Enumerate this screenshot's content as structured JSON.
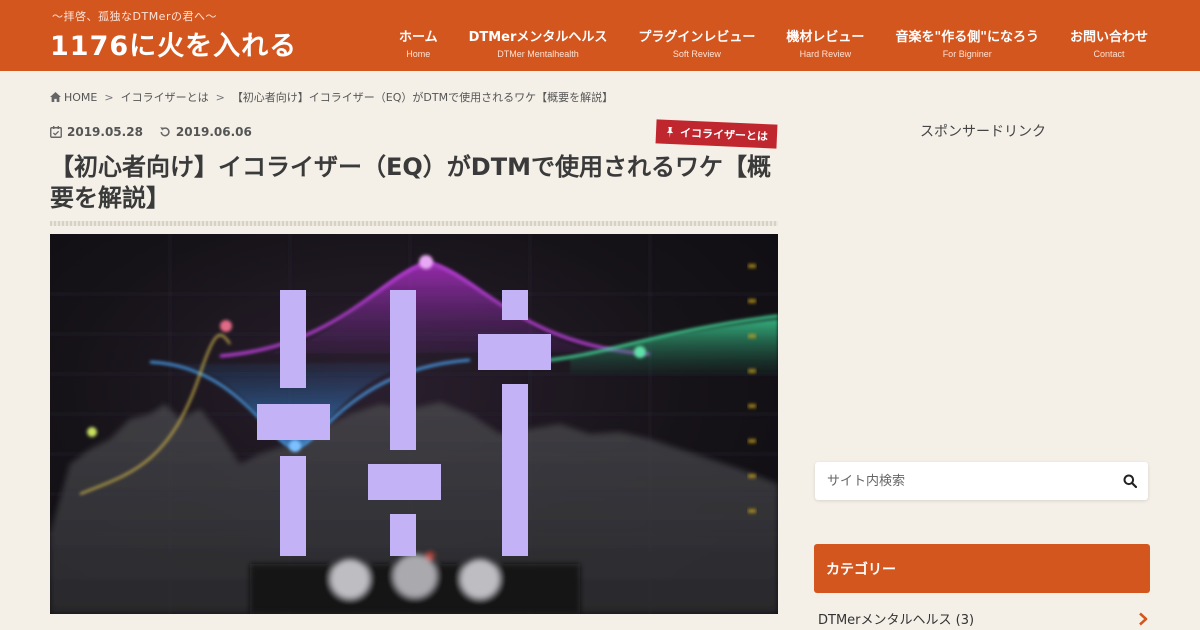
{
  "site": {
    "tagline": "～拝啓、孤独なDTMerの君へ～",
    "title": "1176に火を入れる"
  },
  "nav": [
    {
      "label": "ホーム",
      "sub": "Home"
    },
    {
      "label": "DTMerメンタルヘルス",
      "sub": "DTMer Mentalhealth"
    },
    {
      "label": "プラグインレビュー",
      "sub": "Soft Review"
    },
    {
      "label": "機材レビュー",
      "sub": "Hard Review"
    },
    {
      "label": "音楽を\"作る側\"になろう",
      "sub": "For Bigniner"
    },
    {
      "label": "お問い合わせ",
      "sub": "Contact"
    }
  ],
  "breadcrumb": {
    "home": "HOME",
    "sep": ">",
    "category": "イコライザーとは",
    "current": "【初心者向け】イコライザー（EQ）がDTMで使用されるワケ【概要を解説】"
  },
  "article": {
    "published": "2019.05.28",
    "updated": "2019.06.06",
    "category_badge": "イコライザーとは",
    "title": "【初心者向け】イコライザー（EQ）がDTMで使用されるワケ【概要を解説】"
  },
  "sidebar": {
    "sponsor_label": "スポンサードリンク",
    "search_placeholder": "サイト内検索",
    "categories_heading": "カテゴリー",
    "categories": [
      {
        "label": "DTMerメンタルヘルス (3)"
      }
    ]
  },
  "colors": {
    "brand": "#d4561f",
    "badge": "#c0262e",
    "background": "#f4f0e8",
    "eq_icon": "#c4b2f7"
  }
}
